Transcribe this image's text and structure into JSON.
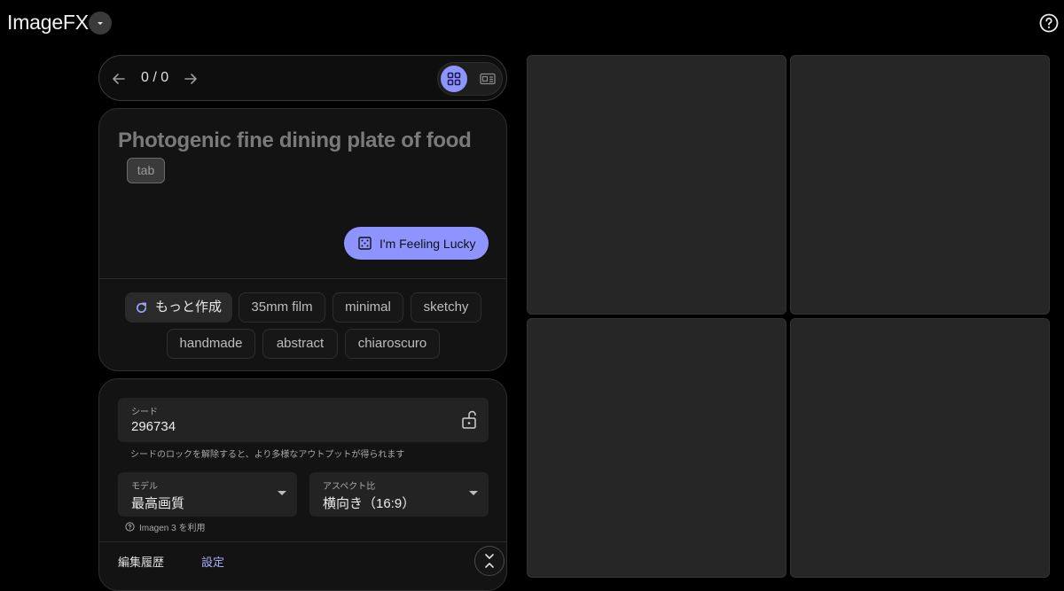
{
  "app": {
    "title": "ImageFX"
  },
  "nav": {
    "counter": "0 / 0"
  },
  "prompt": {
    "placeholder": "Photogenic fine dining plate of food",
    "tab_hint": "tab",
    "lucky_label": "I'm Feeling Lucky"
  },
  "chips": {
    "more_label": "もっと作成",
    "items": [
      "35mm film",
      "minimal",
      "sketchy",
      "handmade",
      "abstract",
      "chiaroscuro"
    ]
  },
  "settings": {
    "seed": {
      "label": "シード",
      "value": "296734",
      "hint": "シードのロックを解除すると、より多様なアウトプットが得られます"
    },
    "model": {
      "label": "モデル",
      "value": "最高画質",
      "hint": "Imagen 3 を利用"
    },
    "aspect": {
      "label": "アスペクト比",
      "value": "横向き（16:9）"
    },
    "history_label": "編集履歴",
    "settings_label": "設定"
  },
  "colors": {
    "accent": "#8e94ff",
    "background": "#000000",
    "card": "#131313"
  },
  "icons": [
    "chevron-down-icon",
    "help-icon",
    "arrow-left-icon",
    "arrow-right-icon",
    "grid-view-icon",
    "single-view-icon",
    "dice-icon",
    "refresh-icon",
    "unlock-icon",
    "collapse-icon"
  ]
}
